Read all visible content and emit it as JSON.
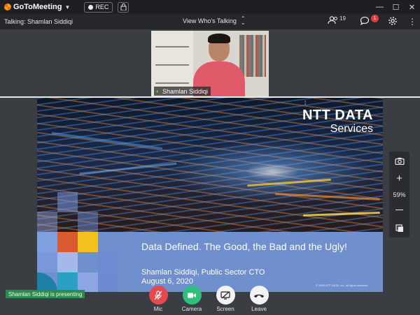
{
  "app": {
    "name": "GoToMeeting",
    "rec_label": "REC"
  },
  "infobar": {
    "talking": "Talking: Shamlan Siddiqi",
    "view_label": "View Who's Talking",
    "attendee_count": "19",
    "chat_badge": "1"
  },
  "webcam": {
    "name": "Shamlan Siddiqi"
  },
  "slide": {
    "brand_line1": "NTT DATA",
    "brand_line2": "Services",
    "title": "Data Defined. The Good, the Bad and the Ugly!",
    "presenter": "Shamlan Siddiqi, Public Sector CTO",
    "date": "August 6, 2020",
    "copyright": "© 2020 NTT DATA, Inc. All rights reserved"
  },
  "zoom": {
    "level": "59%"
  },
  "status": {
    "presenting": "Shamlan Siddiqi is presenting"
  },
  "controls": {
    "mic": "Mic",
    "camera": "Camera",
    "screen": "Screen",
    "leave": "Leave"
  },
  "colors": {
    "mic": "#e5484d",
    "camera": "#2fbf7c",
    "screen": "#f2f2f2",
    "leave": "#f2f2f2",
    "presenting_bg": "#2f8a4e",
    "slide_band": "#6f8fcf"
  },
  "icons": [
    "gotomeeting-logo-icon",
    "record-dot-icon",
    "lock-icon",
    "minimize-icon",
    "maximize-icon",
    "close-icon",
    "sort-icon",
    "people-icon",
    "chat-icon",
    "gear-icon",
    "more-icon",
    "mic-on-icon",
    "camera-snapshot-icon",
    "zoom-in-icon",
    "zoom-out-icon",
    "fit-screen-icon",
    "mic-muted-icon",
    "video-camera-icon",
    "screen-share-off-icon",
    "leave-phone-icon"
  ]
}
